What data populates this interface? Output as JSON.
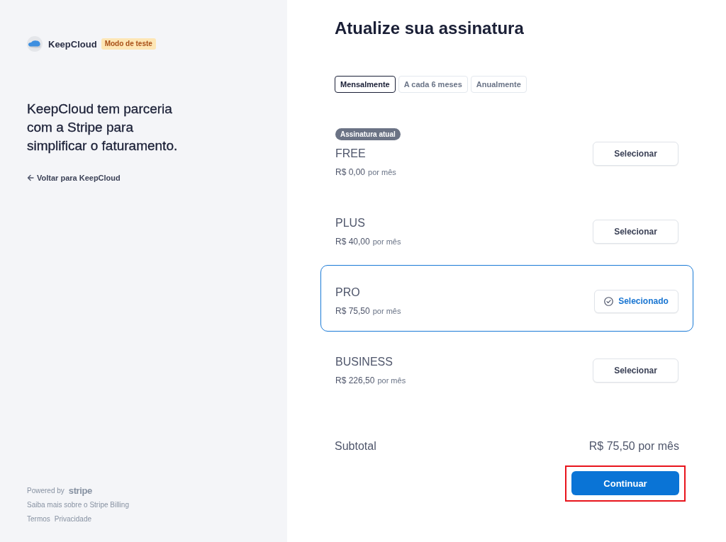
{
  "brand": {
    "name": "KeepCloud",
    "badge": "Modo de teste"
  },
  "headline": "KeepCloud tem parceria com a Stripe para simplificar o faturamento.",
  "back_link": "Voltar para KeepCloud",
  "footer": {
    "powered_by": "Powered by",
    "wordmark": "stripe",
    "learn_more": "Saiba mais sobre o Stripe Billing",
    "links": [
      "Termos",
      "Privacidade"
    ]
  },
  "title": "Atualize sua assinatura",
  "billing_tabs": [
    {
      "label": "Mensalmente",
      "selected": true
    },
    {
      "label": "A cada 6 meses",
      "selected": false
    },
    {
      "label": "Anualmente",
      "selected": false
    }
  ],
  "plans": [
    {
      "badge": "Assinatura atual",
      "name": "FREE",
      "price": "R$ 0,00",
      "period": "por mês",
      "button": "Selecionar",
      "selected": false
    },
    {
      "name": "PLUS",
      "price": "R$ 40,00",
      "period": "por mês",
      "button": "Selecionar",
      "selected": false
    },
    {
      "name": "PRO",
      "price": "R$ 75,50",
      "period": "por mês",
      "button": "Selecionado",
      "selected": true
    },
    {
      "name": "BUSINESS",
      "price": "R$ 226,50",
      "period": "por mês",
      "button": "Selecionar",
      "selected": false
    }
  ],
  "subtotal": {
    "label": "Subtotal",
    "value": "R$ 75,50 por mês"
  },
  "continue_button": {
    "label": "Continuar",
    "highlighted": true
  }
}
